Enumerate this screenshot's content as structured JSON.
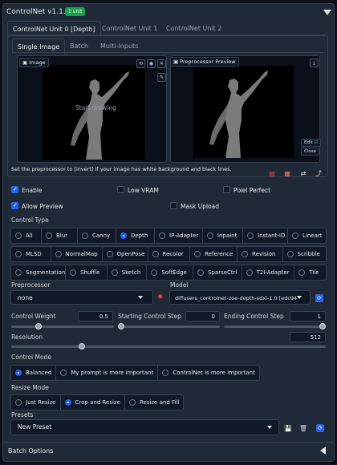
{
  "header": {
    "title": "ControlNet v1.1.445",
    "badge": "1 unit"
  },
  "unit_tabs": [
    "ControlNet Unit 0 [Depth]",
    "ControlNet Unit 1",
    "ControlNet Unit 2"
  ],
  "input_tabs": [
    "Single Image",
    "Batch",
    "Multi-Inputs"
  ],
  "image_panel": {
    "label": "Image",
    "placeholder": "Start drawing"
  },
  "preview_panel": {
    "label": "Preprocessor Preview",
    "edit_label": "Edit",
    "close_label": "Close"
  },
  "hint": "Set the preprocessor to [invert] If your image has white background and black lines.",
  "checkboxes": {
    "enable": "Enable",
    "low_vram": "Low VRAM",
    "pixel_perfect": "Pixel Perfect",
    "allow_preview": "Allow Preview",
    "mask_upload": "Mask Upload"
  },
  "control_type": {
    "label": "Control Type",
    "rows": [
      [
        "All",
        "Blur",
        "Canny",
        "Depth",
        "IP-Adapter",
        "Inpaint",
        "Instant-ID",
        "Lineart"
      ],
      [
        "MLSD",
        "NormalMap",
        "OpenPose",
        "Recolor",
        "Reference",
        "Revision",
        "Scribble"
      ],
      [
        "Segmentation",
        "Shuffle",
        "Sketch",
        "SoftEdge",
        "SparseCtrl",
        "T2I-Adapter",
        "Tile"
      ]
    ],
    "selected": "Depth"
  },
  "preprocessor": {
    "label": "Preprocessor",
    "value": "none"
  },
  "model": {
    "label": "Model",
    "value": "diffusers_controlnet-zoe-depth-sdxl-1.0 [edc94"
  },
  "sliders": {
    "control_weight": {
      "label": "Control Weight",
      "value": "0.5",
      "fraction": 0.25
    },
    "starting_step": {
      "label": "Starting Control Step",
      "value": "0",
      "fraction": 0
    },
    "ending_step": {
      "label": "Ending Control Step",
      "value": "1",
      "fraction": 1
    },
    "resolution": {
      "label": "Resolution",
      "value": "512",
      "fraction": 0.22
    }
  },
  "control_mode": {
    "label": "Control Mode",
    "options": [
      "Balanced",
      "My prompt is more important",
      "ControlNet is more important"
    ],
    "selected": "Balanced"
  },
  "resize_mode": {
    "label": "Resize Mode",
    "options": [
      "Just Resize",
      "Crop and Resize",
      "Resize and Fill"
    ],
    "selected": "Crop and Resize"
  },
  "presets": {
    "label": "Presets",
    "value": "New Preset"
  },
  "batch_options": "Batch Options",
  "colors": {
    "accent": "#2563eb",
    "badge": "#16a34a",
    "panel": "#1f2937",
    "background": "#0b0f19"
  }
}
